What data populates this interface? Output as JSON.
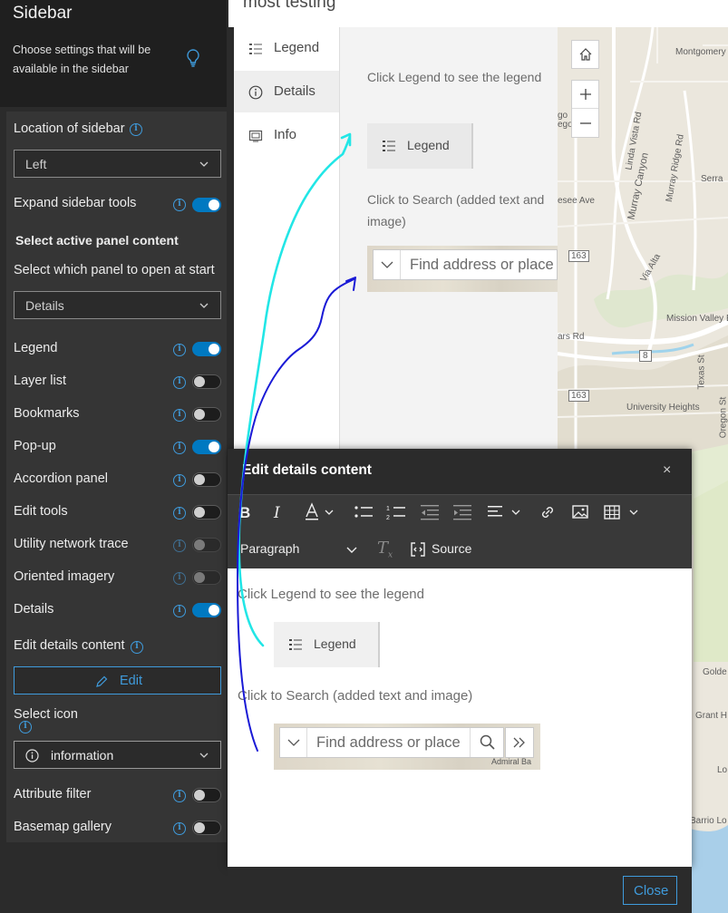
{
  "sidebar": {
    "title": "Sidebar",
    "description": "Choose settings that will be available in the sidebar",
    "location_label": "Location of sidebar",
    "location_value": "Left",
    "expand_tools_label": "Expand sidebar tools",
    "expand_tools_on": true,
    "active_panel_heading": "Select active panel content",
    "open_at_start_label": "Select which panel to open at start",
    "open_at_start_value": "Details",
    "options": [
      {
        "label": "Legend",
        "on": true
      },
      {
        "label": "Layer list",
        "on": false
      },
      {
        "label": "Bookmarks",
        "on": false
      },
      {
        "label": "Pop-up",
        "on": true
      },
      {
        "label": "Accordion panel",
        "on": false
      },
      {
        "label": "Edit tools",
        "on": false
      },
      {
        "label": "Utility network trace",
        "on": false,
        "disabled": true
      },
      {
        "label": "Oriented imagery",
        "on": false,
        "disabled": true
      },
      {
        "label": "Details",
        "on": true
      }
    ],
    "edit_details_label": "Edit details content",
    "edit_button": "Edit",
    "select_icon_label": "Select icon",
    "select_icon_value": "information",
    "attribute_filter_label": "Attribute filter",
    "attribute_filter_on": false,
    "basemap_gallery_label": "Basemap gallery",
    "basemap_gallery_on": false
  },
  "preview": {
    "title": "most testing",
    "nav": [
      {
        "label": "Legend",
        "icon": "legend-icon",
        "active": false
      },
      {
        "label": "Details",
        "icon": "information-icon",
        "active": true
      },
      {
        "label": "Info",
        "icon": "info-card-icon",
        "active": false
      }
    ],
    "details": {
      "legend_text": "Click Legend to see the legend",
      "legend_button": "Legend",
      "search_text": "Click to Search (added text and image)",
      "search_placeholder": "Find address or place"
    }
  },
  "map": {
    "labels": {
      "montgomery": "Montgomery Field",
      "linda_vista": "Linda Vista Rd",
      "murray_ridge": "Murray Ridge Rd",
      "murray_canyon": "Murray Canyon",
      "serra": "Serra",
      "esee": "esee Ave",
      "via_alta": "Via Alta",
      "hwy163a": "163",
      "hwy163b": "163",
      "hwy8": "8",
      "mission_valley": "Mission Valley East",
      "texas": "Texas St",
      "oregon": "Oregon St",
      "university": "University Heights",
      "golden": "Golde",
      "grant": "Grant H",
      "lo": "Lo",
      "barrio": "Barrio Lo",
      "go": "go",
      "ego": "ego",
      "ars": "ars Rd"
    }
  },
  "modal": {
    "title": "Edit details content",
    "close_x": "×",
    "paragraph_label": "Paragraph",
    "source_label": "Source",
    "body": {
      "legend_text": "Click Legend to see the legend",
      "legend_button": "Legend",
      "search_text": "Click to Search (added text and image)",
      "search_placeholder": "Find address or place",
      "map_label": "Admiral Ba"
    },
    "close_button": "Close"
  },
  "colors": {
    "accent": "#0079c1",
    "link_blue": "#3f9bdc",
    "cyan_annotation": "#22e6e6",
    "blue_annotation": "#1a1ad6"
  }
}
